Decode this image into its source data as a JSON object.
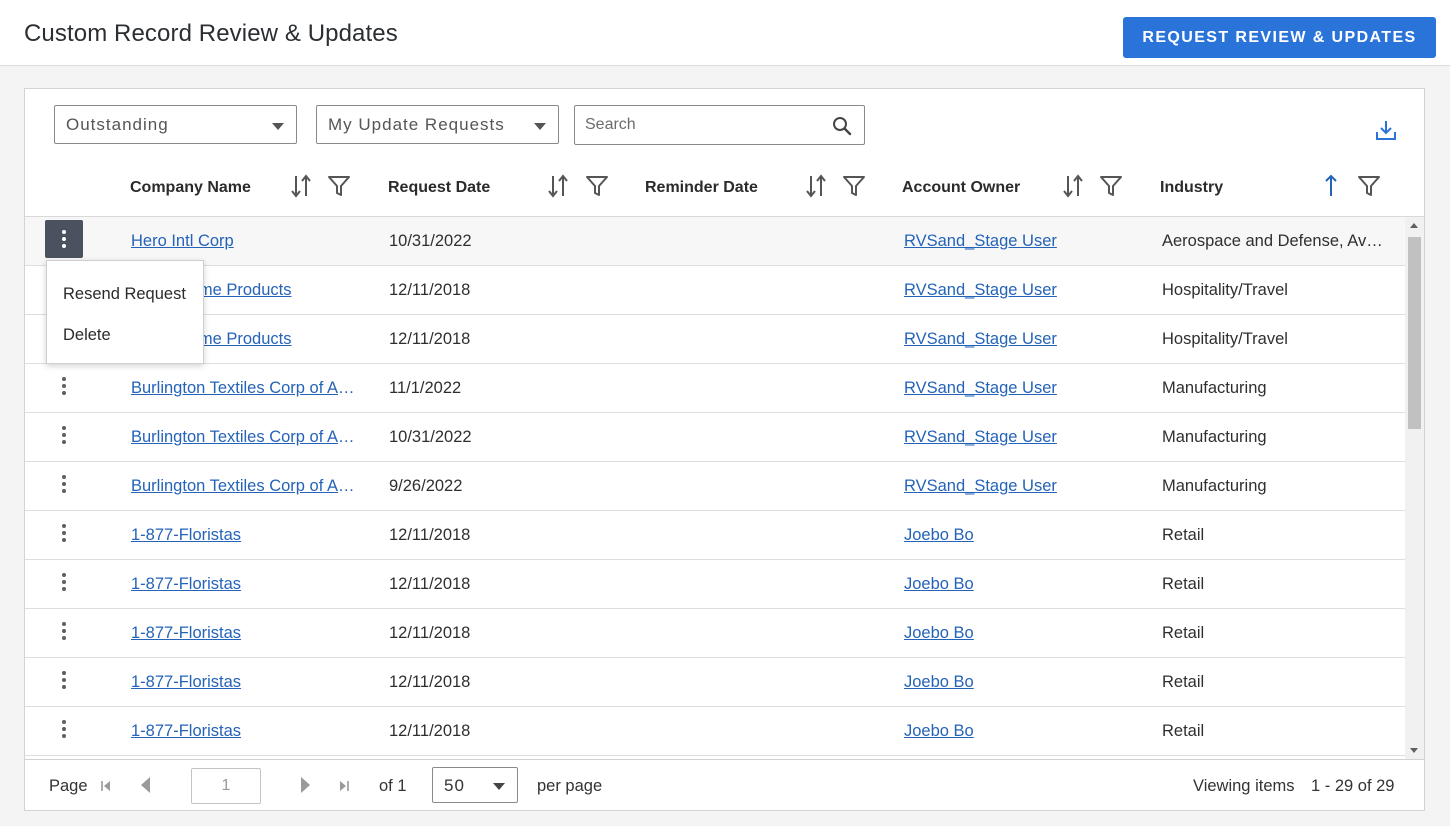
{
  "header": {
    "title": "Custom Record Review & Updates",
    "request_button_label": "REQUEST REVIEW & UPDATES"
  },
  "filters": {
    "status": "Outstanding",
    "scope": "My Update Requests",
    "search_placeholder": "Search"
  },
  "columns": {
    "company": "Company Name",
    "request_date": "Request Date",
    "reminder_date": "Reminder Date",
    "account_owner": "Account Owner",
    "industry": "Industry"
  },
  "rows": [
    {
      "company": "Hero Intl Corp",
      "request_date": "10/31/2022",
      "reminder_date": "",
      "owner": "RVSand_Stage User",
      "industry": "Aerospace and Defense, Aviation"
    },
    {
      "company": "Hilton Home Products",
      "request_date": "12/11/2018",
      "reminder_date": "",
      "owner": "RVSand_Stage User",
      "industry": "Hospitality/Travel"
    },
    {
      "company": "Hilton Home Products",
      "request_date": "12/11/2018",
      "reminder_date": "",
      "owner": "RVSand_Stage User",
      "industry": "Hospitality/Travel"
    },
    {
      "company": "Burlington Textiles Corp of America",
      "request_date": "11/1/2022",
      "reminder_date": "",
      "owner": "RVSand_Stage User",
      "industry": "Manufacturing"
    },
    {
      "company": "Burlington Textiles Corp of America",
      "request_date": "10/31/2022",
      "reminder_date": "",
      "owner": "RVSand_Stage User",
      "industry": "Manufacturing"
    },
    {
      "company": "Burlington Textiles Corp of America",
      "request_date": "9/26/2022",
      "reminder_date": "",
      "owner": "RVSand_Stage User",
      "industry": "Manufacturing"
    },
    {
      "company": "1-877-Floristas",
      "request_date": "12/11/2018",
      "reminder_date": "",
      "owner": "Joebo Bo",
      "industry": "Retail"
    },
    {
      "company": "1-877-Floristas",
      "request_date": "12/11/2018",
      "reminder_date": "",
      "owner": "Joebo Bo",
      "industry": "Retail"
    },
    {
      "company": "1-877-Floristas",
      "request_date": "12/11/2018",
      "reminder_date": "",
      "owner": "Joebo Bo",
      "industry": "Retail"
    },
    {
      "company": "1-877-Floristas",
      "request_date": "12/11/2018",
      "reminder_date": "",
      "owner": "Joebo Bo",
      "industry": "Retail"
    },
    {
      "company": "1-877-Floristas",
      "request_date": "12/11/2018",
      "reminder_date": "",
      "owner": "Joebo Bo",
      "industry": "Retail"
    }
  ],
  "row_menu": {
    "resend": "Resend Request",
    "delete": "Delete"
  },
  "footer": {
    "page_label": "Page",
    "page_value": "1",
    "of_label": "of 1",
    "per_page_value": "50",
    "per_page_label": "per page",
    "viewing_label": "Viewing items",
    "viewing_range": "1 - 29 of 29"
  },
  "colors": {
    "accent": "#2a73d9",
    "link": "#2463b8",
    "sort_active": "#2463b8"
  }
}
